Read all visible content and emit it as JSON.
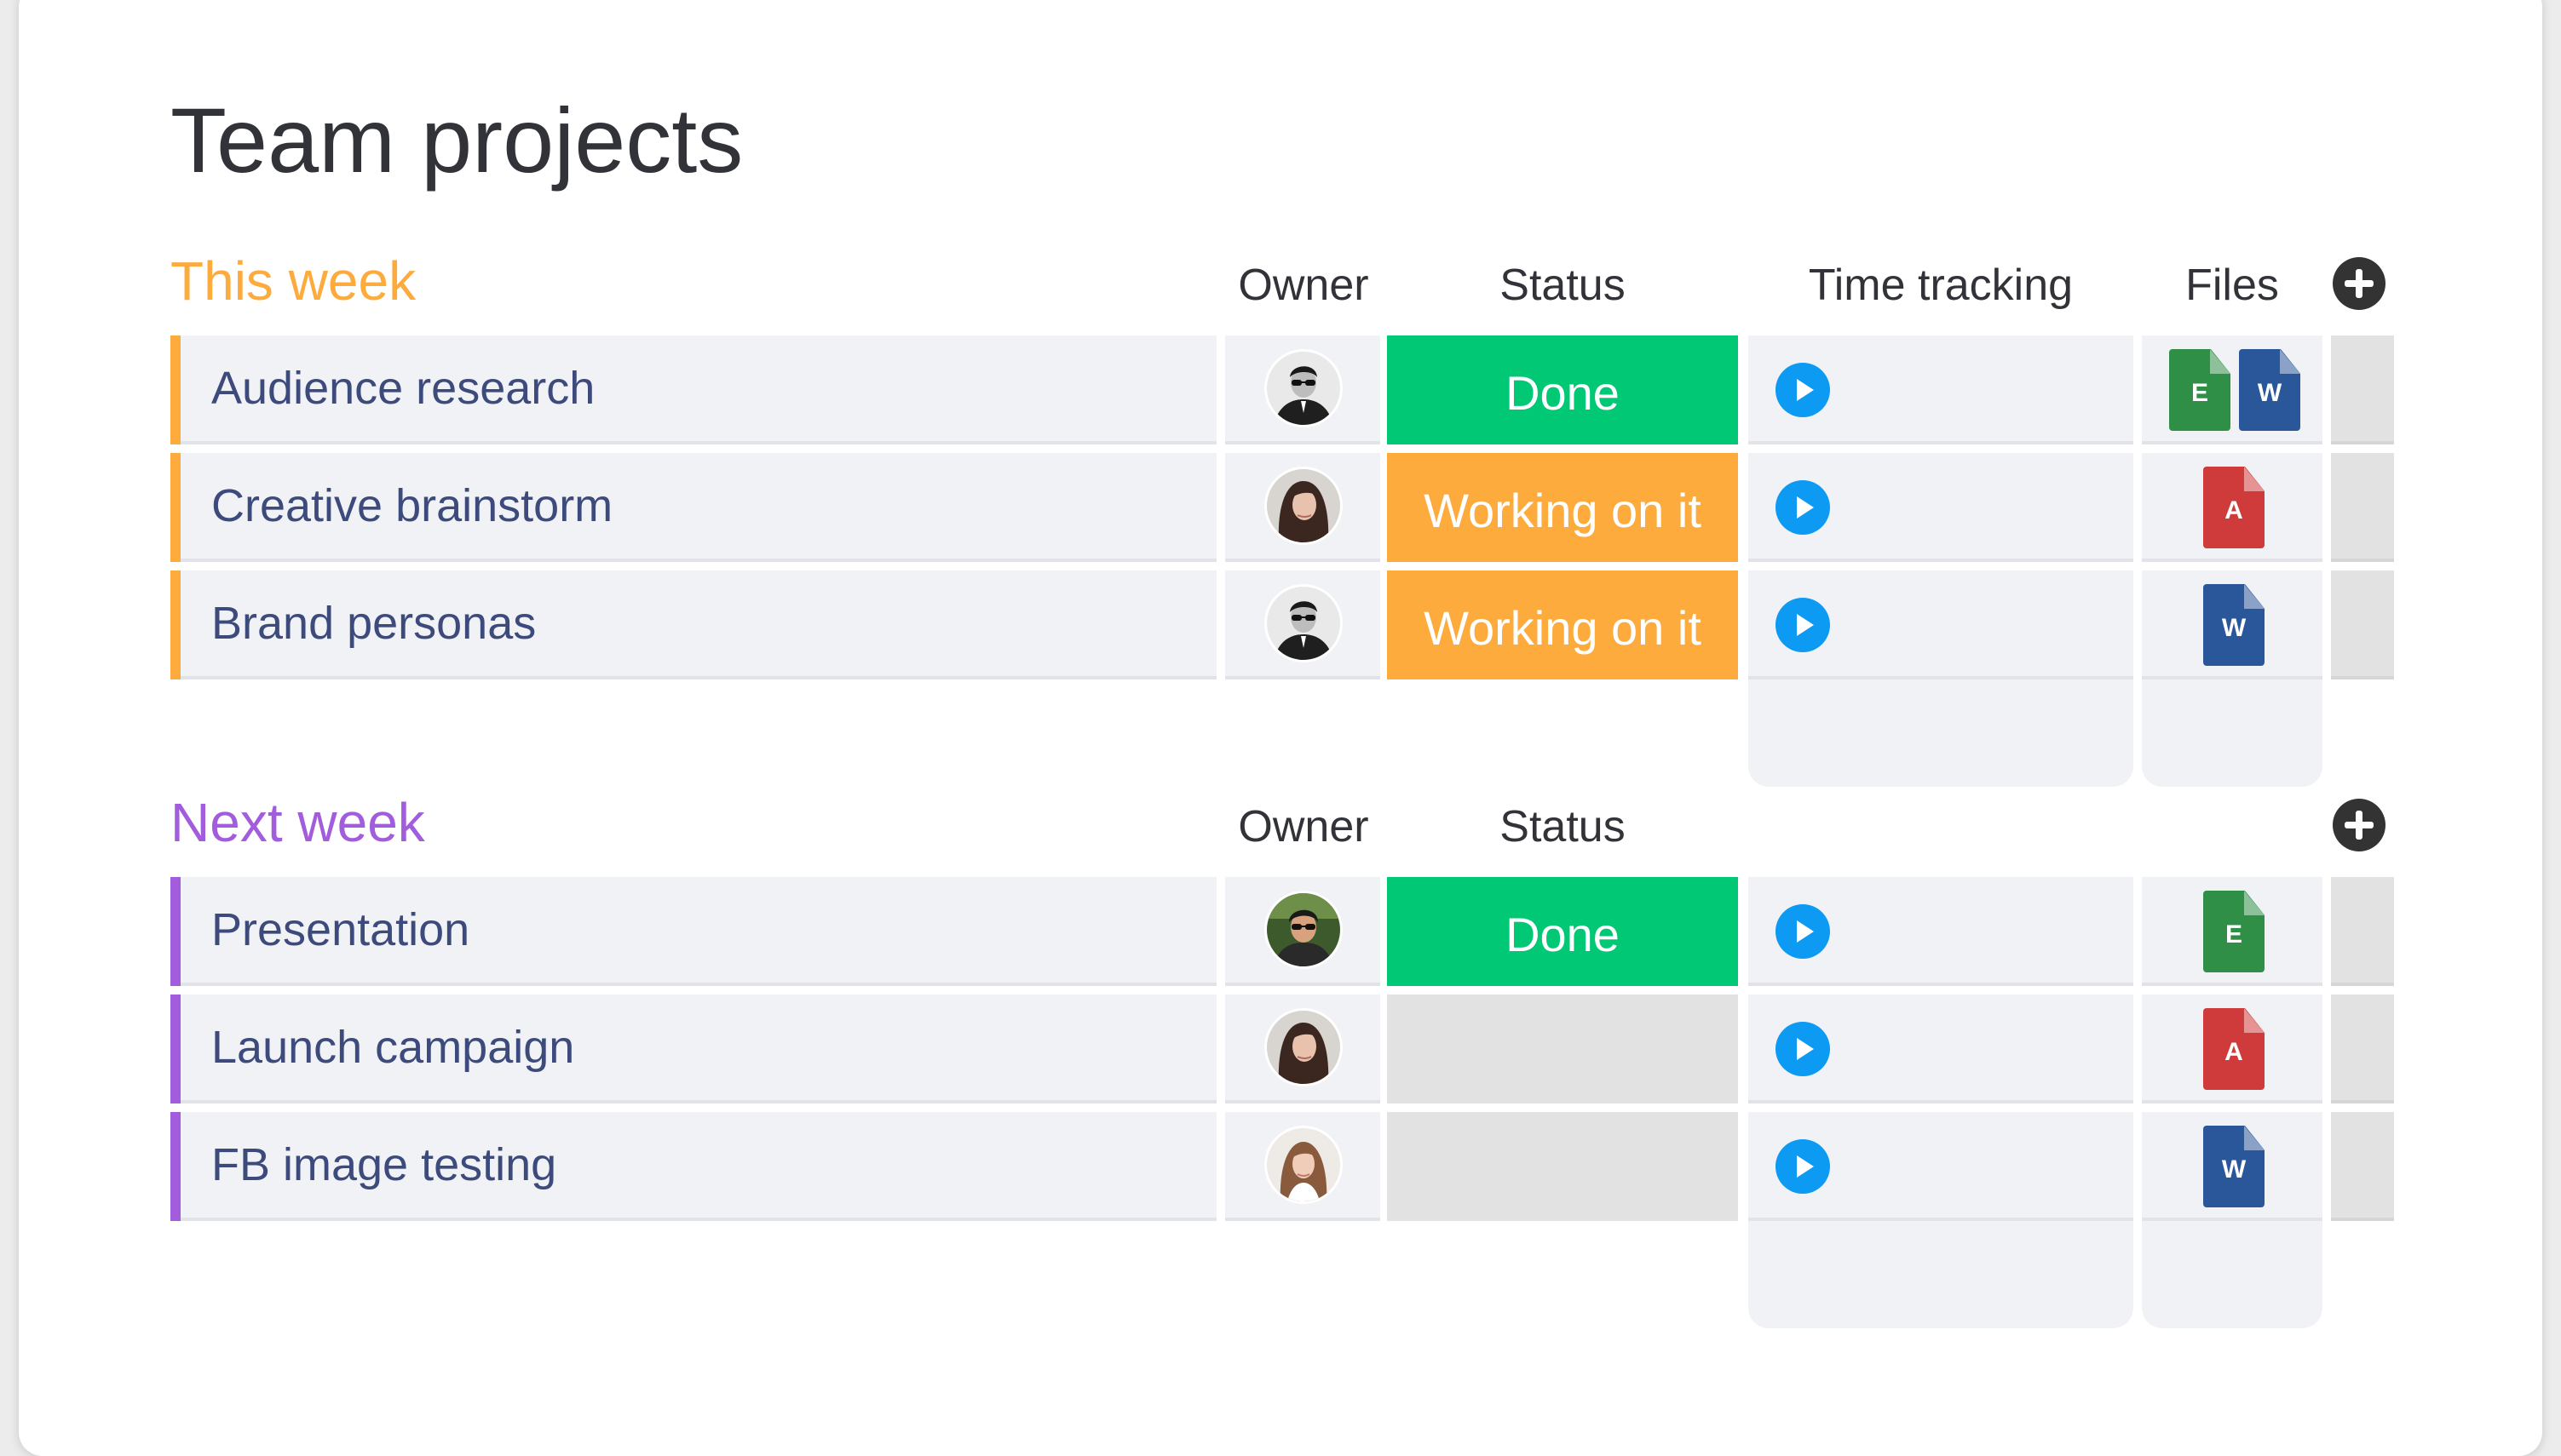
{
  "page": {
    "title": "Team projects"
  },
  "colors": {
    "this_week": "#fdab3d",
    "next_week": "#a25ddc",
    "done": "#00c875",
    "working": "#fdab3d",
    "empty": "#e2e2e2",
    "play": "#0d9af2",
    "excel": "#2f8f46",
    "word": "#2a579a",
    "pdf": "#cf3b3b"
  },
  "groups": [
    {
      "title": "This week",
      "columns": {
        "owner": "Owner",
        "status": "Status",
        "time": "Time tracking",
        "files": "Files"
      },
      "rows": [
        {
          "name": "Audience research",
          "owner": "avatar-man-sunglasses-bw",
          "status": "Done",
          "files": [
            {
              "type": "excel",
              "letter": "E"
            },
            {
              "type": "word",
              "letter": "W"
            }
          ]
        },
        {
          "name": "Creative brainstorm",
          "owner": "avatar-woman-dark-hair",
          "status": "Working on it",
          "files": [
            {
              "type": "pdf",
              "letter": "A"
            }
          ]
        },
        {
          "name": "Brand personas",
          "owner": "avatar-man-sunglasses-bw",
          "status": "Working on it",
          "files": [
            {
              "type": "word",
              "letter": "W"
            }
          ]
        }
      ]
    },
    {
      "title": "Next week",
      "columns": {
        "owner": "Owner",
        "status": "Status"
      },
      "rows": [
        {
          "name": "Presentation",
          "owner": "avatar-man-sunglasses-color",
          "status": "Done",
          "files": [
            {
              "type": "excel",
              "letter": "E"
            }
          ]
        },
        {
          "name": "Launch campaign",
          "owner": "avatar-woman-dark-hair",
          "status": "",
          "files": [
            {
              "type": "pdf",
              "letter": "A"
            }
          ]
        },
        {
          "name": "FB image testing",
          "owner": "avatar-woman-light",
          "status": "",
          "files": [
            {
              "type": "word",
              "letter": "W"
            }
          ]
        }
      ]
    }
  ]
}
